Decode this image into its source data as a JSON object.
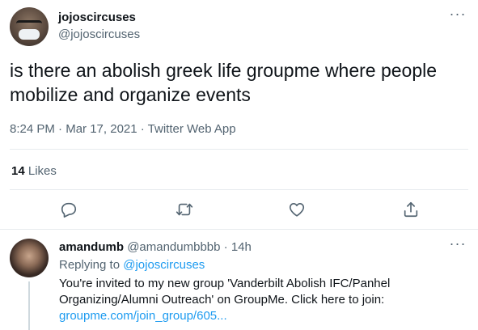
{
  "main_tweet": {
    "author_name": "jojoscircuses",
    "author_handle": "@jojoscircuses",
    "text": "is there an abolish greek life groupme where people mobilize and organize events",
    "time": "8:24 PM",
    "date": "Mar 17, 2021",
    "source": "Twitter Web App",
    "likes_count": "14",
    "likes_label": "Likes",
    "more_icon": "···",
    "actions": [
      "reply-icon",
      "retweet-icon",
      "like-icon",
      "share-icon"
    ]
  },
  "reply": {
    "author_name": "amandumb",
    "author_handle": "@amandumbbbb",
    "time_ago": "14h",
    "replying_label": "Replying to",
    "replying_to": "@jojoscircuses",
    "text": "You're invited to my new group 'Vanderbilt Abolish IFC/Panhel Organizing/Alumni Outreach' on GroupMe. Click here to join:",
    "link": "groupme.com/join_group/605...",
    "more_icon": "···"
  },
  "colors": {
    "text": "#0f1419",
    "secondary": "#536471",
    "link": "#1d9bf0",
    "divider": "#e7ebee"
  }
}
